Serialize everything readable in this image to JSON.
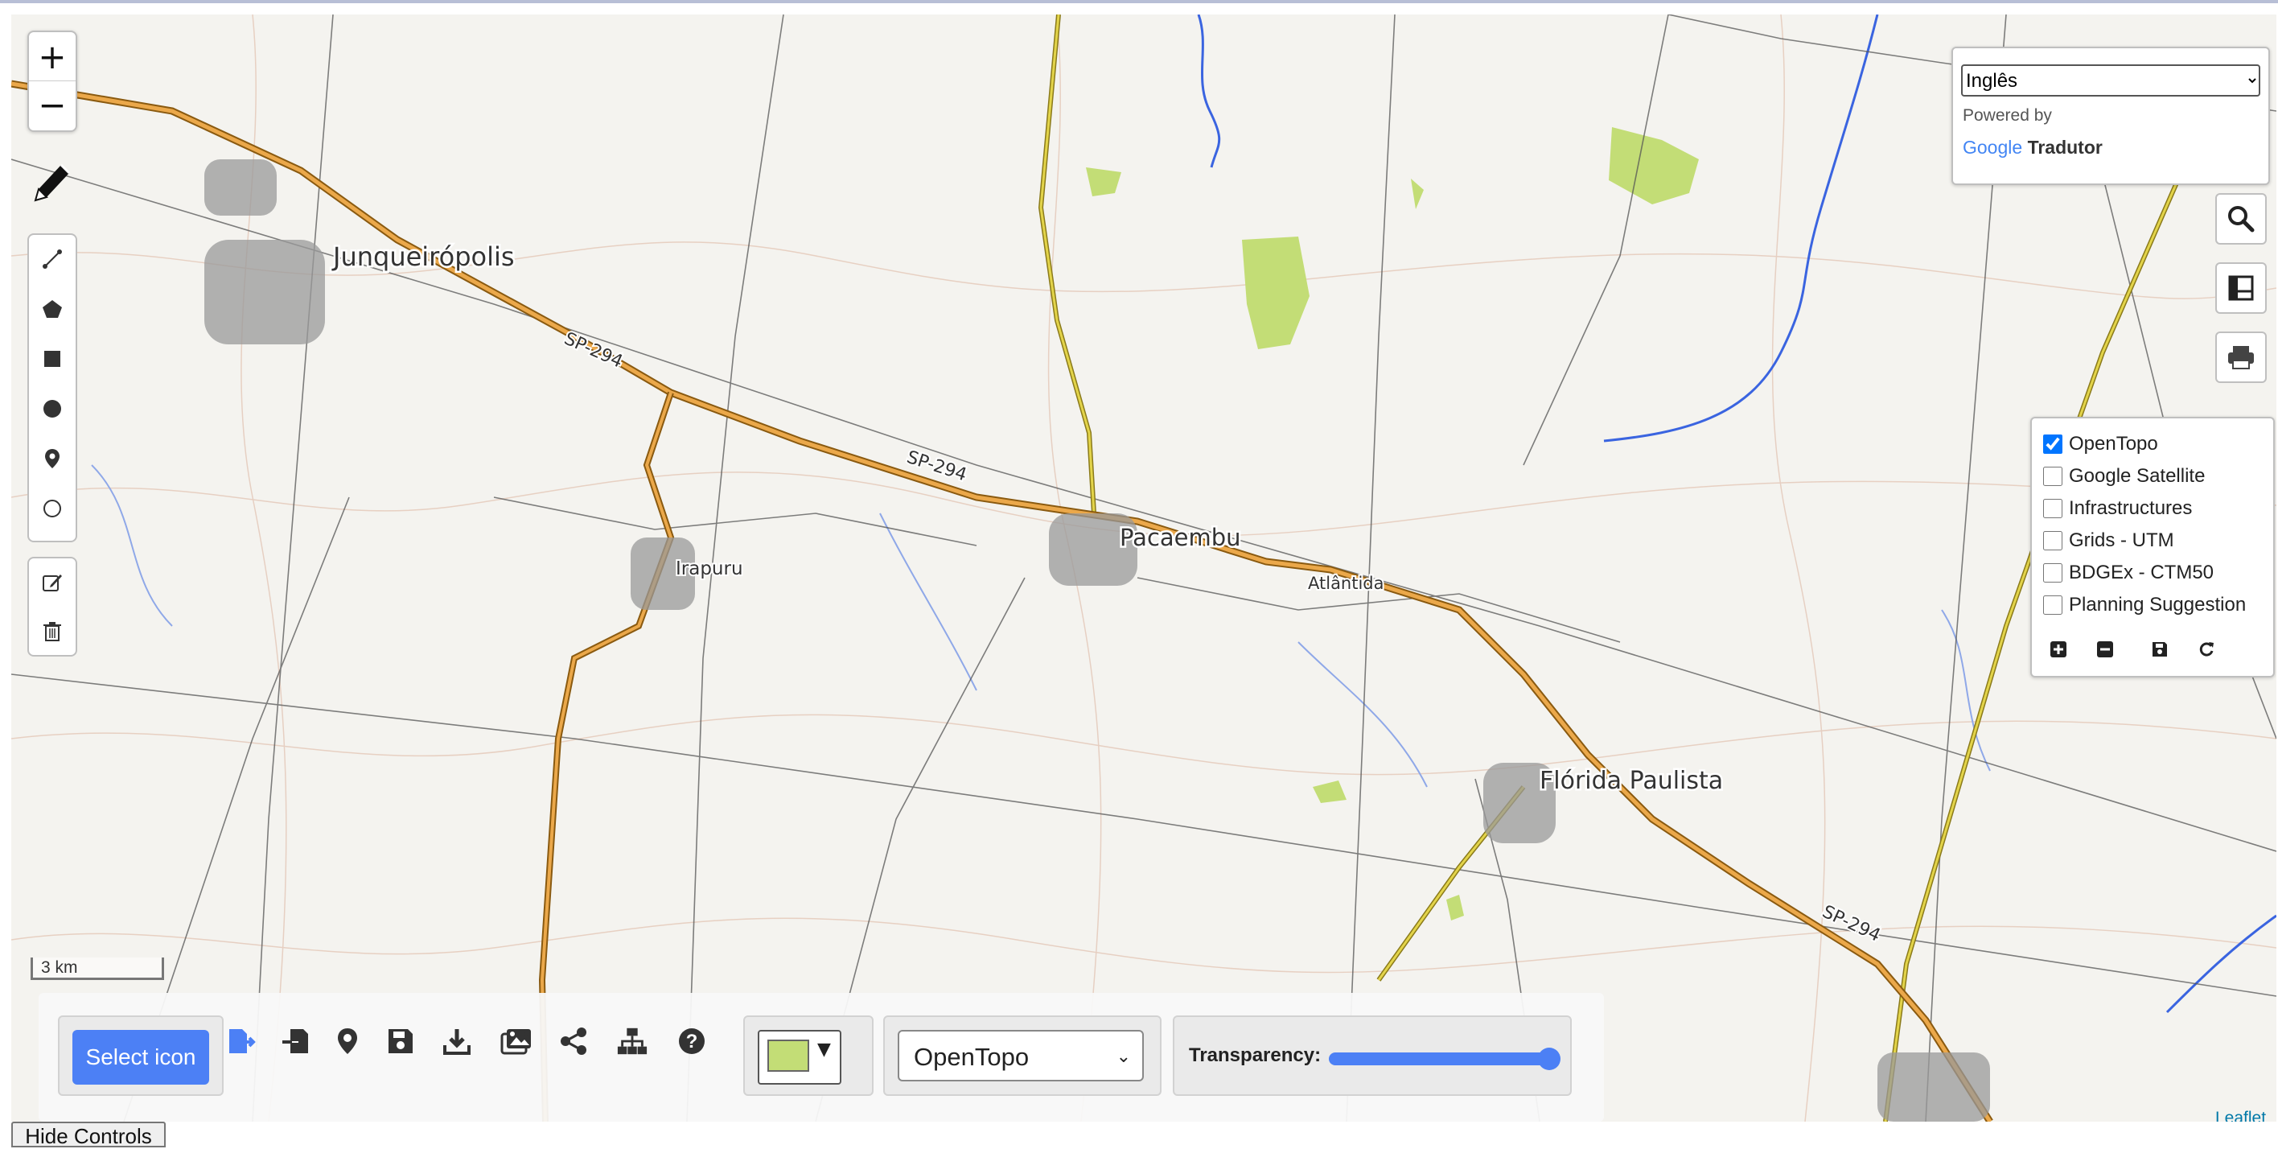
{
  "map": {
    "places": {
      "junqueiropolis": "Junqueirópolis",
      "irapuru": "Irapuru",
      "pacaembu": "Pacaembu",
      "atlantida": "Atlântida",
      "florida_paulista": "Flórida Paulista"
    },
    "roads": {
      "sp294_a": "SP-294",
      "sp294_b": "SP-294",
      "sp294_c": "SP-294"
    },
    "scale_label": "3 km",
    "attribution": "Leaflet"
  },
  "zoom": {
    "in_label": "+",
    "out_label": "−"
  },
  "draw_toolbar": {
    "tools": [
      "polyline-icon",
      "polygon-icon",
      "rectangle-icon",
      "circle-icon",
      "marker-icon",
      "circlemarker-icon"
    ],
    "edit": [
      "edit-icon",
      "trash-icon"
    ]
  },
  "translate": {
    "language": "Inglês",
    "powered_by": "Powered by",
    "google": "Google",
    "tradutor": "Tradutor"
  },
  "right_buttons": [
    "search-icon",
    "ruler-icon",
    "print-icon"
  ],
  "layers": {
    "items": [
      {
        "label": "OpenTopo",
        "checked": true
      },
      {
        "label": "Google Satellite",
        "checked": false
      },
      {
        "label": "Infrastructures",
        "checked": false
      },
      {
        "label": "Grids - UTM",
        "checked": false
      },
      {
        "label": "BDGEx - CTM50",
        "checked": false
      },
      {
        "label": "Planning Suggestion",
        "checked": false
      }
    ],
    "actions": [
      "plus-square-icon",
      "minus-square-icon",
      "save-icon",
      "refresh-icon"
    ]
  },
  "bottom": {
    "select_icon_label": "Select icon",
    "icons": [
      "export-icon",
      "import-icon",
      "location-pin-icon",
      "save-icon",
      "download-icon",
      "images-icon",
      "share-icon",
      "sitemap-icon",
      "help-icon"
    ],
    "fill_color": "#c3dd76",
    "basemap": "OpenTopo",
    "transparency_label": "Transparency:",
    "transparency_value": 0.97
  },
  "hide_controls_label": "Hide Controls",
  "colors": {
    "accent": "#4c80f5",
    "road": "#d79a3b",
    "water": "#3a64e0",
    "forest": "#c3dd76"
  }
}
